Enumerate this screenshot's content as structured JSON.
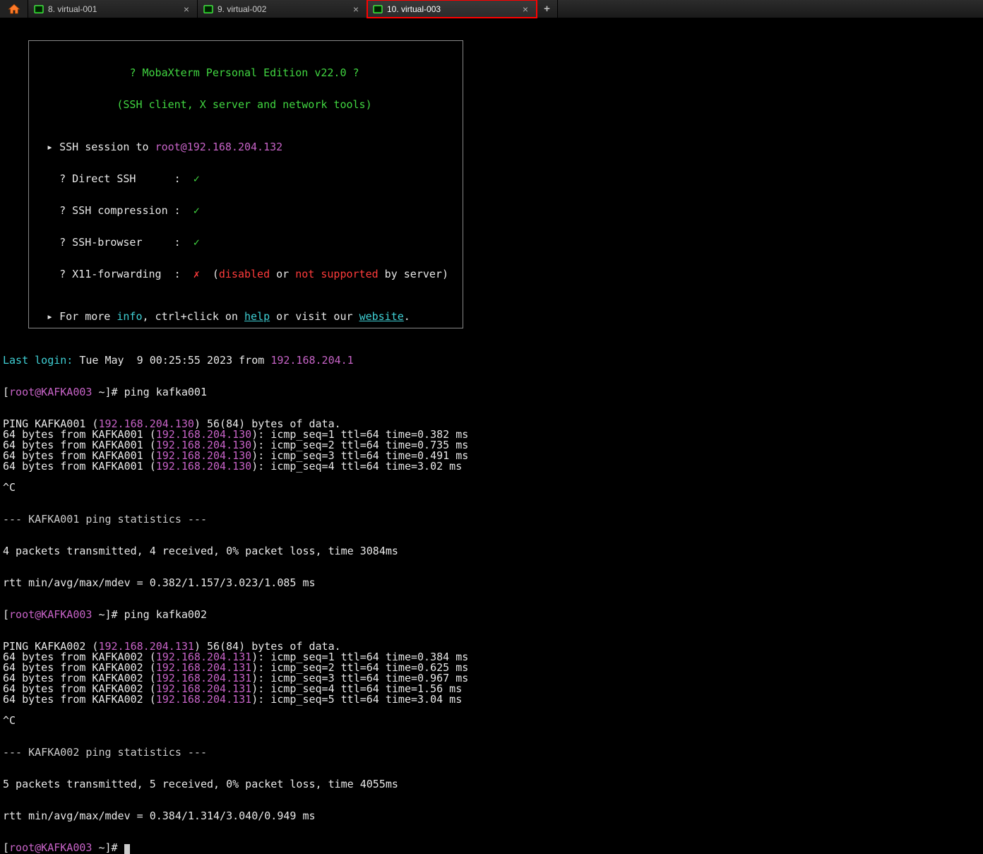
{
  "tabs": [
    {
      "label": "8. virtual-001",
      "active": false
    },
    {
      "label": "9. virtual-002",
      "active": false
    },
    {
      "label": "10. virtual-003",
      "active": true,
      "highlighted": true
    }
  ],
  "banner": {
    "title_q1": "? ",
    "title": "MobaXterm Personal Edition v22.0",
    "title_q2": " ?",
    "subtitle": "(SSH client, X server and network tools)",
    "ssh_session_label": "SSH session to ",
    "ssh_session_target": "root@192.168.204.132",
    "rows": [
      {
        "label": "? Direct SSH      :",
        "status": "ok"
      },
      {
        "label": "? SSH compression :",
        "status": "ok"
      },
      {
        "label": "? SSH-browser     :",
        "status": "ok"
      },
      {
        "label": "? X11-forwarding  :",
        "status": "fail",
        "extra_pre": "  (",
        "extra_disabled": "disabled",
        "extra_or": " or ",
        "extra_not_supported": "not supported",
        "extra_post": " by server)"
      }
    ],
    "more_pre": "For more ",
    "more_info": "info",
    "more_mid": ", ctrl+click on ",
    "more_help": "help",
    "more_or": " or visit our ",
    "more_website": "website",
    "more_end": "."
  },
  "session": {
    "last_login_label": "Last login:",
    "last_login_time": " Tue May  9 00:25:55 2023 from ",
    "last_login_ip": "192.168.204.1",
    "prompt_open": "[",
    "prompt_userhost": "root@KAFKA003",
    "prompt_path": " ~",
    "prompt_close": "]# ",
    "ping_cmd1": "ping kafka001",
    "ping_cmd2": "ping kafka002"
  },
  "hosts": [
    {
      "name": "KAFKA001",
      "ip": "192.168.204.130"
    },
    {
      "name": "KAFKA002",
      "ip": "192.168.204.131"
    }
  ],
  "ping1": {
    "header_pre": "PING KAFKA001 (",
    "header_ip": "192.168.204.130",
    "header_post": ") 56(84) bytes of data.",
    "replies": [
      {
        "seq": "1",
        "ttl": "64",
        "time": "0.382"
      },
      {
        "seq": "2",
        "ttl": "64",
        "time": "0.735"
      },
      {
        "seq": "3",
        "ttl": "64",
        "time": "0.491"
      },
      {
        "seq": "4",
        "ttl": "64",
        "time": "3.02"
      }
    ],
    "ctrlc": "^C",
    "stats_header": "--- KAFKA001 ping statistics ---",
    "stats_line1": "4 packets transmitted, 4 received, 0% packet loss, time 3084ms",
    "stats_line2": "rtt min/avg/max/mdev = 0.382/1.157/3.023/1.085 ms"
  },
  "ping2": {
    "header_pre": "PING KAFKA002 (",
    "header_ip": "192.168.204.131",
    "header_post": ") 56(84) bytes of data.",
    "replies": [
      {
        "seq": "1",
        "ttl": "64",
        "time": "0.384"
      },
      {
        "seq": "2",
        "ttl": "64",
        "time": "0.625"
      },
      {
        "seq": "3",
        "ttl": "64",
        "time": "0.967"
      },
      {
        "seq": "4",
        "ttl": "64",
        "time": "1.56"
      },
      {
        "seq": "5",
        "ttl": "64",
        "time": "3.04"
      }
    ],
    "ctrlc": "^C",
    "stats_header": "--- KAFKA002 ping statistics ---",
    "stats_line1": "5 packets transmitted, 5 received, 0% packet loss, time 4055ms",
    "stats_line2": "rtt min/avg/max/mdev = 0.384/1.314/3.040/0.949 ms"
  }
}
